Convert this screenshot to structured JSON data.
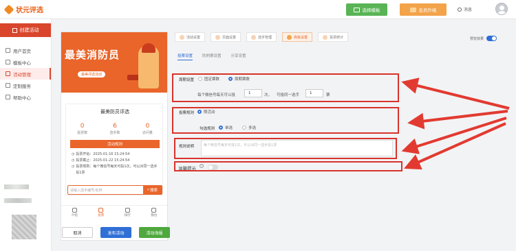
{
  "topbar": {
    "logo": "状元评选",
    "template_btn": "选择模板",
    "vip_btn": "会员升级",
    "message": "消息"
  },
  "sidebar": {
    "create_btn": "创建活动",
    "items": [
      {
        "label": "用户首页",
        "active": false
      },
      {
        "label": "模板中心",
        "active": false
      },
      {
        "label": "活动管理",
        "active": true
      },
      {
        "label": "定制服务",
        "active": false
      },
      {
        "label": "帮助中心",
        "active": false
      }
    ]
  },
  "preview": {
    "banner_title": "最美消防员",
    "banner_tag": "最美评选活动",
    "card_title": "最美防员评选",
    "stats": [
      {
        "value": "0",
        "label": "投票数"
      },
      {
        "value": "6",
        "label": "选手数"
      },
      {
        "value": "0",
        "label": "访问量"
      }
    ],
    "rules_btn": "活动规则",
    "info": [
      "投票开始：2025-01-16 15:24:54",
      "投票截止：2025-01-22 15:24:54",
      "投票规则：每个微信号每天可投1次，可以对同一选手投1票"
    ],
    "search_placeholder": "请输入选手编号/名称",
    "search_btn": "搜索",
    "tabs": [
      {
        "label": "介绍",
        "active": false
      },
      {
        "label": "投票",
        "active": true
      },
      {
        "label": "排行",
        "active": false
      },
      {
        "label": "我也",
        "active": false
      }
    ]
  },
  "footer_buttons": [
    "取消",
    "发布活动",
    "活动海报"
  ],
  "steps": [
    {
      "label": "活动设置",
      "active": false
    },
    {
      "label": "页面设置",
      "active": false
    },
    {
      "label": "选手管理",
      "active": false
    },
    {
      "label": "高级设置",
      "active": true
    },
    {
      "label": "投票统计",
      "active": false
    }
  ],
  "preview_toggle_label": "预览效果",
  "subtabs": [
    {
      "label": "投票设置",
      "active": true
    },
    {
      "label": "防刷票设置",
      "active": false
    },
    {
      "label": "分享设置",
      "active": false
    }
  ],
  "form": {
    "cycle_label": "周期设置",
    "cycle_options": [
      {
        "label": "固定票数",
        "selected": false
      },
      {
        "label": "周期票数",
        "selected": true
      }
    ],
    "per_day_prefix": "每个微信号每天可以投",
    "per_day_value": "1",
    "per_day_unit": "次，",
    "same_player_prefix": "可投同一选手",
    "same_player_value": "1",
    "same_player_unit": "票",
    "vote_rule_label": "投票规则",
    "vote_rule_option": "限活动",
    "check_rule_label": "勾选规则",
    "check_options": [
      {
        "label": "单选",
        "selected": true
      },
      {
        "label": "多选",
        "selected": false
      }
    ],
    "rule_desc_label": "规则说明",
    "rule_desc_placeholder": "每个微信号每天可投1次，可以对同一选手投1票",
    "reminder_label": "温馨提示"
  }
}
